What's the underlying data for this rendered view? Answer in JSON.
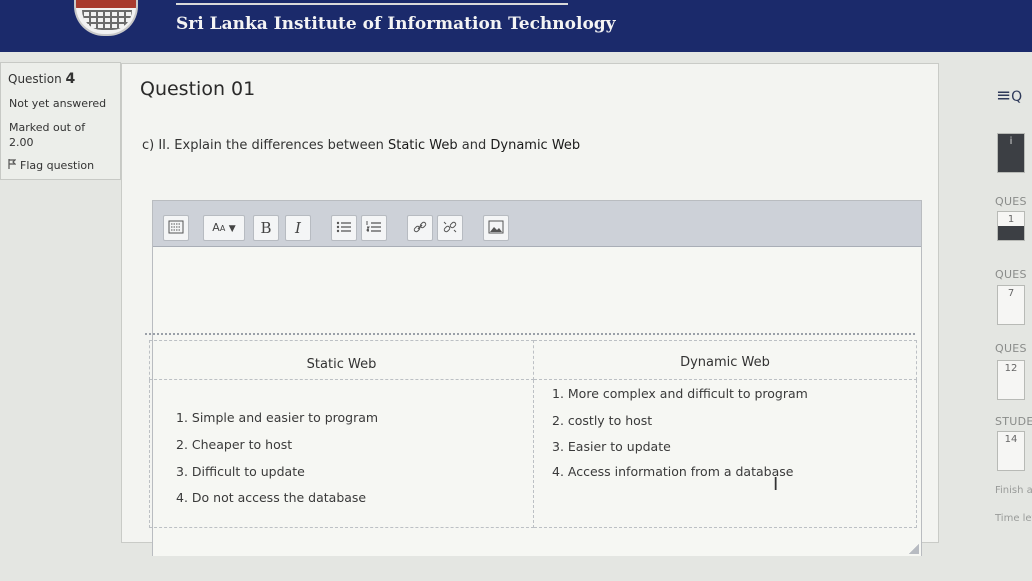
{
  "header": {
    "site_title": "Sri Lanka Institute of Information Technology"
  },
  "question_info": {
    "label": "Question",
    "number": "4",
    "status": "Not yet answered",
    "marked_label": "Marked out of",
    "marked_value": "2.00",
    "flag_label": "Flag question"
  },
  "question": {
    "title": "Question 01",
    "prefix": "c) II. Explain the differences between ",
    "term1": "Static Web",
    "mid": " and ",
    "term2": "Dynamic Web"
  },
  "toolbar": {
    "font_size_label": "A",
    "bold_label": "B",
    "italic_label": "I"
  },
  "answer_table": {
    "col1_header": "Static Web",
    "col2_header": "Dynamic Web",
    "static_items": [
      "1. Simple and easier to program",
      "2. Cheaper to host",
      "3. Difficult to update",
      "4. Do not access the database"
    ],
    "dynamic_items": [
      "1. More complex and difficult to program",
      "2. costly to host",
      "3. Easier to update",
      "4. Access information from a database"
    ]
  },
  "navigation": {
    "menu_icon": "≡",
    "menu_partial": "Q",
    "section_labels": [
      "QUES",
      "QUES",
      "QUES",
      "STUDE"
    ],
    "boxes": [
      "1",
      "7",
      "12",
      "14"
    ],
    "first_box": "i",
    "finish_text": "Finish at",
    "time_text": "Time left"
  },
  "colors": {
    "header_bg": "#1b2a6b",
    "page_bg": "#e4e6e2",
    "toolbar_bg": "#cdd1d8"
  }
}
